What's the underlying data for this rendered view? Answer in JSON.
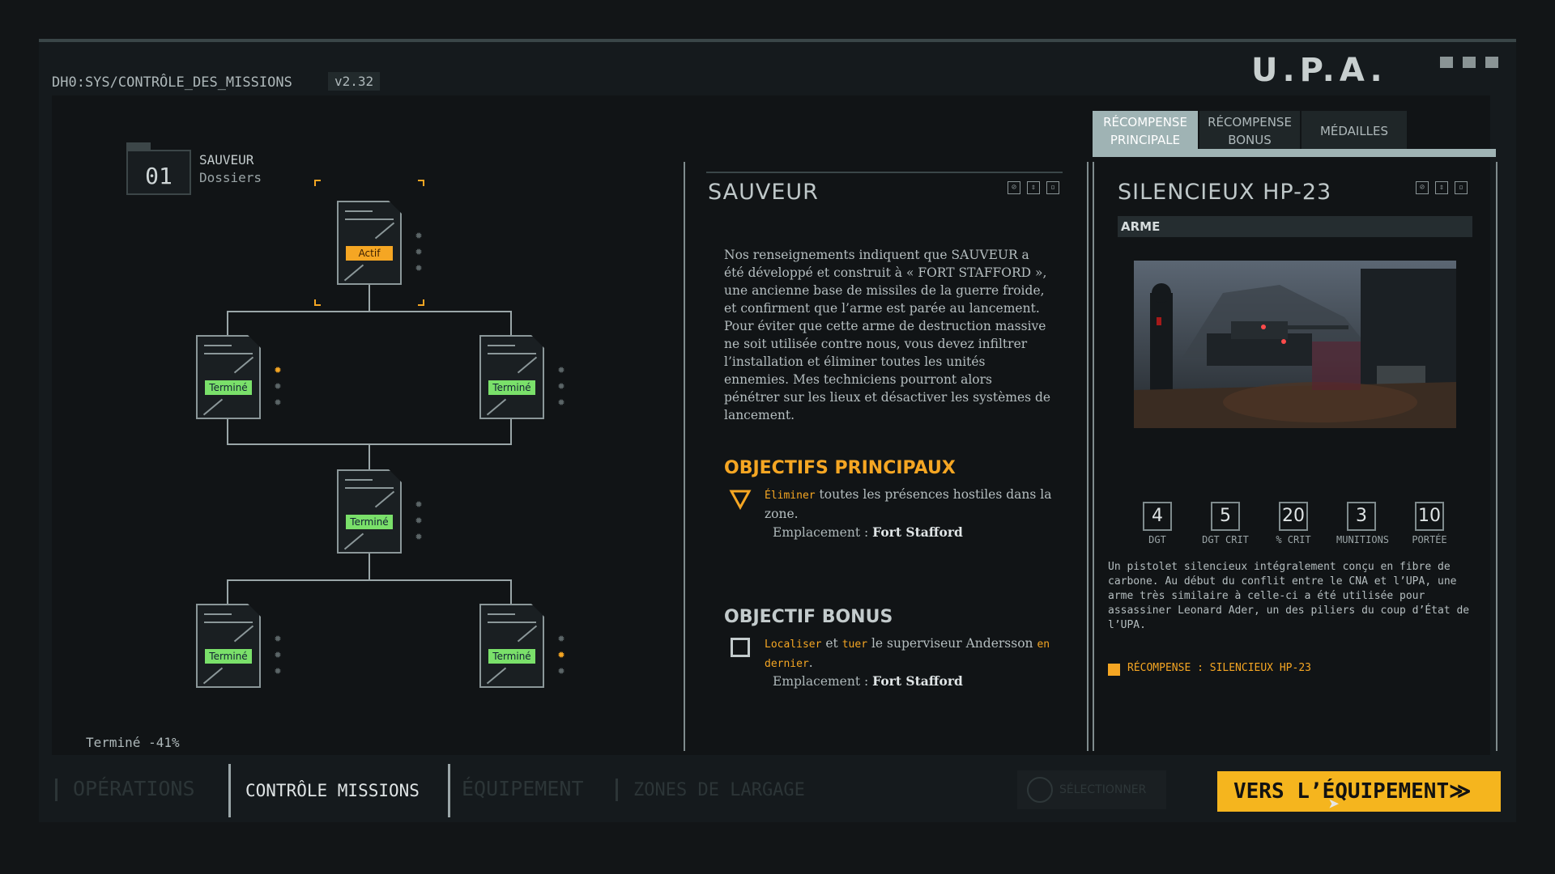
{
  "header": {
    "path": "DH0:SYS/CONTRÔLE_DES_MISSIONS",
    "version": "v2.32",
    "logo": "U.P.A."
  },
  "mission_tree": {
    "folder_number": "01",
    "folder_title": "SAUVEUR",
    "folder_subtitle": "Dossiers",
    "nodes": [
      {
        "status": "Actif",
        "stars_earned": 0
      },
      {
        "status": "Terminé",
        "stars_earned": 1
      },
      {
        "status": "Terminé",
        "stars_earned": 0
      },
      {
        "status": "Terminé",
        "stars_earned": 0
      },
      {
        "status": "Terminé",
        "stars_earned": 0
      },
      {
        "status": "Terminé",
        "stars_earned": 1
      }
    ],
    "progress_label": "Terminé -41%"
  },
  "mission": {
    "title": "SAUVEUR",
    "briefing": "Nos renseignements indiquent que SAUVEUR a été développé et construit à « FORT STAFFORD », une ancienne base de missiles de la guerre froide, et confirment que l’arme est parée au lancement. Pour éviter que cette arme de destruction massive ne soit utilisée contre nous, vous devez infiltrer l’installation et éliminer toutes les unités ennemies. Mes techniciens pourront alors pénétrer sur les lieux et désactiver les systèmes de lancement.",
    "main_objectives_title": "OBJECTIFS PRINCIPAUX",
    "main_objective": {
      "highlight": "Éliminer",
      "text": " toutes les présences hostiles dans la zone.",
      "location_label": "Emplacement : ",
      "location": "Fort Stafford"
    },
    "bonus_objective_title": "OBJECTIF BONUS",
    "bonus_objective": {
      "highlight1": "Localiser",
      "mid1": " et ",
      "highlight2": "tuer",
      "mid2": " le superviseur Andersson ",
      "highlight3": "en dernier",
      "end": ".",
      "location_label": "Emplacement : ",
      "location": "Fort Stafford"
    }
  },
  "tabs": [
    {
      "line1": "RÉCOMPENSE",
      "line2": "PRINCIPALE",
      "active": true
    },
    {
      "line1": "RÉCOMPENSE",
      "line2": "BONUS",
      "active": false
    },
    {
      "line1": "MÉDAILLES",
      "line2": "",
      "active": false
    }
  ],
  "reward": {
    "title": "SILENCIEUX HP-23",
    "category": "ARME",
    "stats": [
      {
        "value": "4",
        "label": "DGT"
      },
      {
        "value": "5",
        "label": "DGT CRIT"
      },
      {
        "value": "20",
        "label": "% CRIT"
      },
      {
        "value": "3",
        "label": "MUNITIONS"
      },
      {
        "value": "10",
        "label": "PORTÉE"
      }
    ],
    "description": "Un pistolet silencieux intégralement conçu en fibre de carbone. Au début du conflit entre le CNA et l’UPA, une arme très similaire à celle-ci a été utilisée pour assassiner Leonard Ader, un des piliers du coup d’État de l’UPA.",
    "reward_line": "RÉCOMPENSE : SILENCIEUX HP-23"
  },
  "footer": {
    "nav": [
      "OPÉRATIONS",
      "CONTRÔLE MISSIONS",
      "ÉQUIPEMENT",
      "ZONES DE LARGAGE"
    ],
    "select_label": "SÉLECTIONNER",
    "cta": "VERS L’ÉQUIPEMENT≫"
  },
  "colors": {
    "accent": "#f5a623",
    "done": "#7ae06a",
    "cta": "#f5b51e"
  }
}
